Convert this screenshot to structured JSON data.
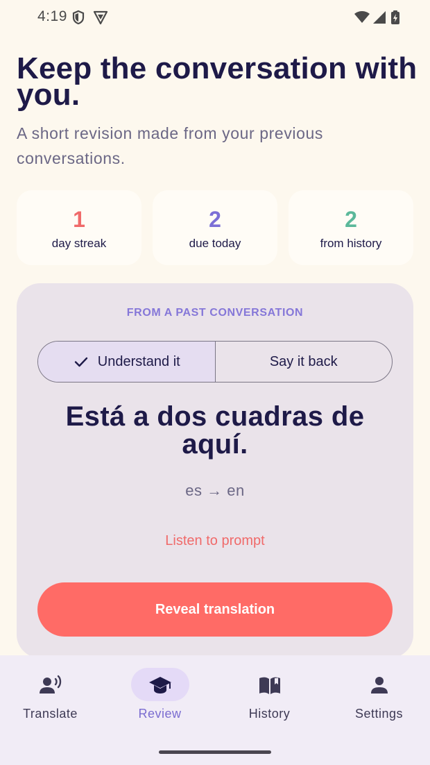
{
  "status_bar": {
    "time": "4:19"
  },
  "header": {
    "title": "Keep the conversation with you.",
    "subtitle": "A short revision made from your previous conversations."
  },
  "stats": [
    {
      "value": "1",
      "label": "day streak",
      "color": "#F06A6A"
    },
    {
      "value": "2",
      "label": "due today",
      "color": "#7B6FD6"
    },
    {
      "value": "2",
      "label": "from history",
      "color": "#5BB89A"
    }
  ],
  "review_card": {
    "eyebrow": "FROM A PAST CONVERSATION",
    "modes": [
      {
        "label": "Understand it",
        "selected": true
      },
      {
        "label": "Say it back",
        "selected": false
      }
    ],
    "prompt": "Está a dos cuadras de aquí.",
    "language_pair": "es → en",
    "listen_label": "Listen to prompt",
    "reveal_label": "Reveal translation"
  },
  "bottom_nav": {
    "items": [
      {
        "label": "Translate",
        "icon": "speaking-person-icon",
        "active": false
      },
      {
        "label": "Review",
        "icon": "graduation-cap-icon",
        "active": true
      },
      {
        "label": "History",
        "icon": "open-book-icon",
        "active": false
      },
      {
        "label": "Settings",
        "icon": "person-icon",
        "active": false
      }
    ]
  },
  "colors": {
    "background": "#FDF8EE",
    "title": "#1E1A48",
    "accent_coral": "#FF6B66",
    "accent_purple": "#7A6CD0"
  }
}
